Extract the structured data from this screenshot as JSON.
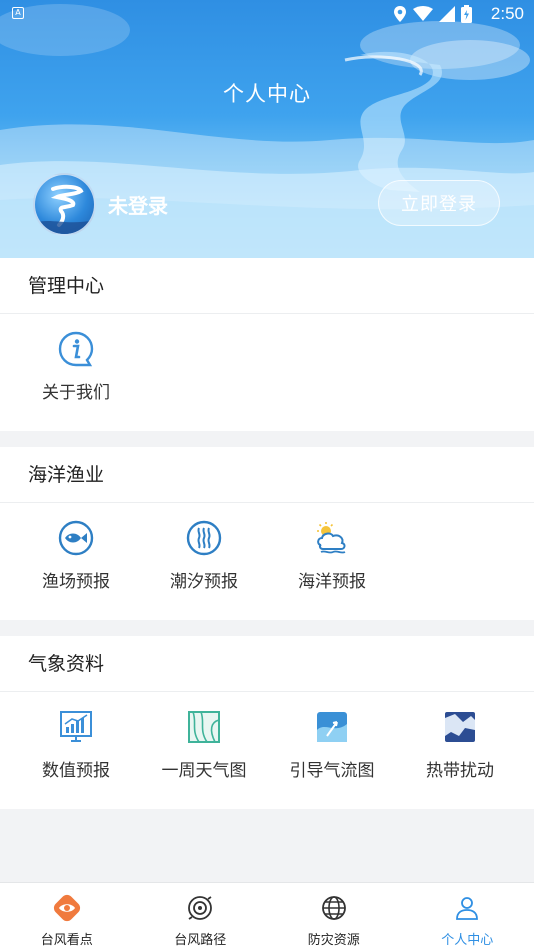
{
  "status_bar": {
    "time": "2:50",
    "left_badge": "A"
  },
  "header": {
    "title": "个人中心",
    "login_status": "未登录",
    "login_button": "立即登录"
  },
  "sections": [
    {
      "title": "管理中心",
      "items": [
        {
          "label": "关于我们",
          "icon": "info-icon"
        }
      ]
    },
    {
      "title": "海洋渔业",
      "items": [
        {
          "label": "渔场预报",
          "icon": "fish-icon"
        },
        {
          "label": "潮汐预报",
          "icon": "tide-icon"
        },
        {
          "label": "海洋预报",
          "icon": "ocean-weather-icon"
        }
      ]
    },
    {
      "title": "气象资料",
      "items": [
        {
          "label": "数值预报",
          "icon": "chart-icon"
        },
        {
          "label": "一周天气图",
          "icon": "weather-map-icon"
        },
        {
          "label": "引导气流图",
          "icon": "airflow-map-icon"
        },
        {
          "label": "热带扰动",
          "icon": "tropical-disturbance-icon"
        }
      ]
    }
  ],
  "bottom_nav": [
    {
      "label": "台风看点",
      "icon": "typhoon-eye-icon",
      "active": false
    },
    {
      "label": "台风路径",
      "icon": "typhoon-path-icon",
      "active": false
    },
    {
      "label": "防灾资源",
      "icon": "globe-icon",
      "active": false
    },
    {
      "label": "个人中心",
      "icon": "user-icon",
      "active": true
    }
  ],
  "colors": {
    "accent": "#2f8fe3",
    "background": "#f2f3f5"
  }
}
